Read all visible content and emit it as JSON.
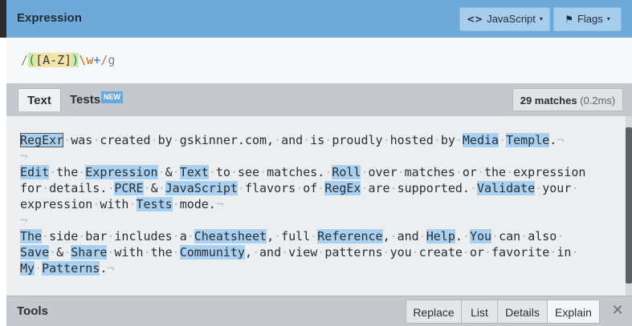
{
  "expression_panel": {
    "title": "Expression",
    "flavor_icon": "code-icon",
    "flavor_glyph": "<>",
    "flavor_label": "JavaScript",
    "flags_icon": "flag-icon",
    "flags_glyph": "⚑",
    "flags_label": "Flags",
    "caret": "▾",
    "tokens": {
      "open_delim": "/",
      "group_open": "(",
      "set": "[A-Z]",
      "group_close": ")",
      "word_class": "\\w",
      "quantifier": "+",
      "close_delim": "/",
      "flags": "g"
    }
  },
  "text_panel": {
    "tabs": [
      {
        "label": "Text",
        "active": true
      },
      {
        "label": "Tests",
        "badge": "NEW"
      }
    ],
    "match_count": "29 matches",
    "match_time": "(0.2ms)",
    "lines": [
      [
        {
          "t": "RegExr",
          "m": true,
          "sel": true
        },
        {
          "t": "·",
          "d": true
        },
        {
          "t": "was"
        },
        {
          "t": "·",
          "d": true
        },
        {
          "t": "created"
        },
        {
          "t": "·",
          "d": true
        },
        {
          "t": "by"
        },
        {
          "t": "·",
          "d": true
        },
        {
          "t": "gskinner.com,"
        },
        {
          "t": "·",
          "d": true
        },
        {
          "t": "and"
        },
        {
          "t": "·",
          "d": true
        },
        {
          "t": "is"
        },
        {
          "t": "·",
          "d": true
        },
        {
          "t": "proudly"
        },
        {
          "t": "·",
          "d": true
        },
        {
          "t": "hosted"
        },
        {
          "t": "·",
          "d": true
        },
        {
          "t": "by"
        },
        {
          "t": "·",
          "d": true
        },
        {
          "t": "Media",
          "m": true
        },
        {
          "t": "·",
          "d": true
        },
        {
          "t": "Temple",
          "m": true
        },
        {
          "t": "."
        },
        {
          "t": "¬",
          "d": true
        }
      ],
      [
        {
          "t": "¬",
          "d": true
        }
      ],
      [
        {
          "t": "Edit",
          "m": true
        },
        {
          "t": "·",
          "d": true
        },
        {
          "t": "the"
        },
        {
          "t": "·",
          "d": true
        },
        {
          "t": "Expression",
          "m": true
        },
        {
          "t": "·",
          "d": true
        },
        {
          "t": "&"
        },
        {
          "t": "·",
          "d": true
        },
        {
          "t": "Text",
          "m": true
        },
        {
          "t": "·",
          "d": true
        },
        {
          "t": "to"
        },
        {
          "t": "·",
          "d": true
        },
        {
          "t": "see"
        },
        {
          "t": "·",
          "d": true
        },
        {
          "t": "matches."
        },
        {
          "t": "·",
          "d": true
        },
        {
          "t": "Roll",
          "m": true
        },
        {
          "t": "·",
          "d": true
        },
        {
          "t": "over"
        },
        {
          "t": "·",
          "d": true
        },
        {
          "t": "matches"
        },
        {
          "t": "·",
          "d": true
        },
        {
          "t": "or"
        },
        {
          "t": "·",
          "d": true
        },
        {
          "t": "the"
        },
        {
          "t": "·",
          "d": true
        },
        {
          "t": "expression"
        }
      ],
      [
        {
          "t": "for"
        },
        {
          "t": "·",
          "d": true
        },
        {
          "t": "details."
        },
        {
          "t": "·",
          "d": true
        },
        {
          "t": "PCRE",
          "m": true
        },
        {
          "t": "·",
          "d": true
        },
        {
          "t": "&"
        },
        {
          "t": "·",
          "d": true
        },
        {
          "t": "JavaScript",
          "m": true
        },
        {
          "t": "·",
          "d": true
        },
        {
          "t": "flavors"
        },
        {
          "t": "·",
          "d": true
        },
        {
          "t": "of"
        },
        {
          "t": "·",
          "d": true
        },
        {
          "t": "RegEx",
          "m": true
        },
        {
          "t": "·",
          "d": true
        },
        {
          "t": "are"
        },
        {
          "t": "·",
          "d": true
        },
        {
          "t": "supported."
        },
        {
          "t": "·",
          "d": true
        },
        {
          "t": "Validate",
          "m": true
        },
        {
          "t": "·",
          "d": true
        },
        {
          "t": "your"
        },
        {
          "t": "·",
          "d": true
        }
      ],
      [
        {
          "t": "expression"
        },
        {
          "t": "·",
          "d": true
        },
        {
          "t": "with"
        },
        {
          "t": "·",
          "d": true
        },
        {
          "t": "Tests",
          "m": true
        },
        {
          "t": "·",
          "d": true
        },
        {
          "t": "mode."
        },
        {
          "t": "¬",
          "d": true
        }
      ],
      [
        {
          "t": "¬",
          "d": true
        }
      ],
      [
        {
          "t": "The",
          "m": true
        },
        {
          "t": "·",
          "d": true
        },
        {
          "t": "side"
        },
        {
          "t": "·",
          "d": true
        },
        {
          "t": "bar"
        },
        {
          "t": "·",
          "d": true
        },
        {
          "t": "includes"
        },
        {
          "t": "·",
          "d": true
        },
        {
          "t": "a"
        },
        {
          "t": "·",
          "d": true
        },
        {
          "t": "Cheatsheet",
          "m": true
        },
        {
          "t": ","
        },
        {
          "t": "·",
          "d": true
        },
        {
          "t": "full"
        },
        {
          "t": "·",
          "d": true
        },
        {
          "t": "Reference",
          "m": true
        },
        {
          "t": ","
        },
        {
          "t": "·",
          "d": true
        },
        {
          "t": "and"
        },
        {
          "t": "·",
          "d": true
        },
        {
          "t": "Help",
          "m": true
        },
        {
          "t": "."
        },
        {
          "t": "·",
          "d": true
        },
        {
          "t": "You",
          "m": true
        },
        {
          "t": "·",
          "d": true
        },
        {
          "t": "can"
        },
        {
          "t": "·",
          "d": true
        },
        {
          "t": "also"
        },
        {
          "t": "·",
          "d": true
        }
      ],
      [
        {
          "t": "Save",
          "m": true
        },
        {
          "t": "·",
          "d": true
        },
        {
          "t": "&"
        },
        {
          "t": "·",
          "d": true
        },
        {
          "t": "Share",
          "m": true
        },
        {
          "t": "·",
          "d": true
        },
        {
          "t": "with"
        },
        {
          "t": "·",
          "d": true
        },
        {
          "t": "the"
        },
        {
          "t": "·",
          "d": true
        },
        {
          "t": "Community",
          "m": true
        },
        {
          "t": ","
        },
        {
          "t": "·",
          "d": true
        },
        {
          "t": "and"
        },
        {
          "t": "·",
          "d": true
        },
        {
          "t": "view"
        },
        {
          "t": "·",
          "d": true
        },
        {
          "t": "patterns"
        },
        {
          "t": "·",
          "d": true
        },
        {
          "t": "you"
        },
        {
          "t": "·",
          "d": true
        },
        {
          "t": "create"
        },
        {
          "t": "·",
          "d": true
        },
        {
          "t": "or"
        },
        {
          "t": "·",
          "d": true
        },
        {
          "t": "favorite"
        },
        {
          "t": "·",
          "d": true
        },
        {
          "t": "in"
        },
        {
          "t": "·",
          "d": true
        }
      ],
      [
        {
          "t": "My",
          "m": true
        },
        {
          "t": "·",
          "d": true
        },
        {
          "t": "Patterns",
          "m": true
        },
        {
          "t": "."
        },
        {
          "t": "¬",
          "d": true
        }
      ]
    ]
  },
  "tools_panel": {
    "title": "Tools",
    "buttons": [
      {
        "label": "Replace"
      },
      {
        "label": "List"
      },
      {
        "label": "Details"
      },
      {
        "label": "Explain",
        "active": true
      }
    ],
    "close_glyph": "✕"
  }
}
